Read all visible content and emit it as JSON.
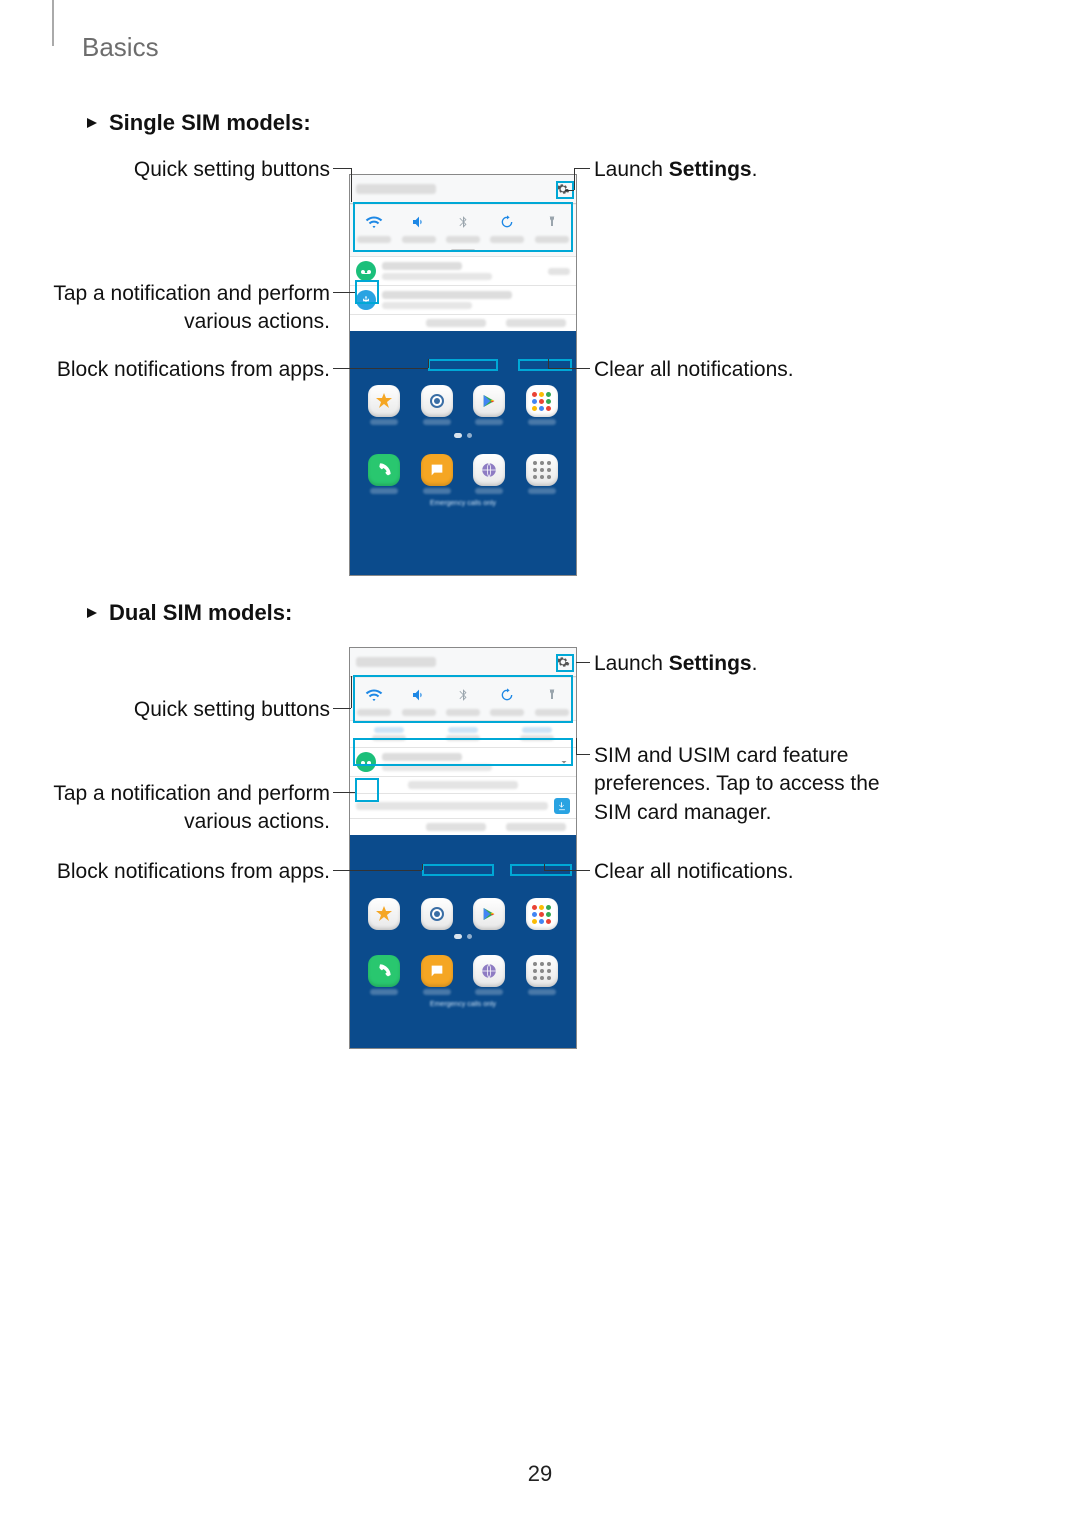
{
  "page": {
    "section": "Basics",
    "number": "29"
  },
  "sections": [
    {
      "heading": "Single SIM models",
      "suffix": ":",
      "left_callouts": [
        {
          "text_plain": "Quick setting buttons"
        },
        {
          "text_line1": "Tap a notification and perform",
          "text_line2": "various actions."
        },
        {
          "text_plain": "Block notifications from apps."
        }
      ],
      "right_callouts": [
        {
          "prefix": "Launch ",
          "bold": "Settings",
          "suffix": "."
        },
        {
          "text_plain": "Clear all notifications."
        }
      ],
      "quick_settings": [
        "Wi-Fi",
        "Sound",
        "Bluetooth",
        "Auto rotate",
        "Torch"
      ],
      "notification_actions": [
        "BLOCK NOTIFICATIONS",
        "CLEAR ALL"
      ],
      "home_apps_row1": [
        "Gallery",
        "Camera",
        "Play Store",
        "Google"
      ],
      "home_apps_row2": [
        "Phone",
        "Messages",
        "Internet",
        "Apps"
      ],
      "bottom_hint": "Emergency calls only"
    },
    {
      "heading": "Dual SIM models",
      "suffix": ":",
      "left_callouts": [
        {
          "text_plain": "Quick setting buttons"
        },
        {
          "text_line1": "Tap a notification and perform",
          "text_line2": "various actions."
        },
        {
          "text_plain": "Block notifications from apps."
        }
      ],
      "right_callouts": [
        {
          "prefix": "Launch ",
          "bold": "Settings",
          "suffix": "."
        },
        {
          "text_line1": "SIM and USIM card feature",
          "text_line2": "preferences. Tap to access the",
          "text_line3": "SIM card manager."
        },
        {
          "text_plain": "Clear all notifications."
        }
      ],
      "sim_pref_columns": [
        "Calls",
        "Text messages",
        "Mobile data"
      ],
      "quick_settings": [
        "Wi-Fi",
        "Sound",
        "Bluetooth",
        "Auto rotate",
        "Torch"
      ],
      "notification_actions": [
        "BLOCK NOTIFICATIONS",
        "CLEAR ALL"
      ],
      "home_apps_row1": [
        "Gallery",
        "Camera",
        "Play Store",
        "Google"
      ],
      "home_apps_row2": [
        "Phone",
        "Messages",
        "Internet",
        "Apps"
      ],
      "bottom_hint": "Emergency calls only"
    }
  ],
  "colors": {
    "highlight": "#00a8d6",
    "qs_active": "#1e88e5",
    "bg_home": "#0b4b8c"
  }
}
